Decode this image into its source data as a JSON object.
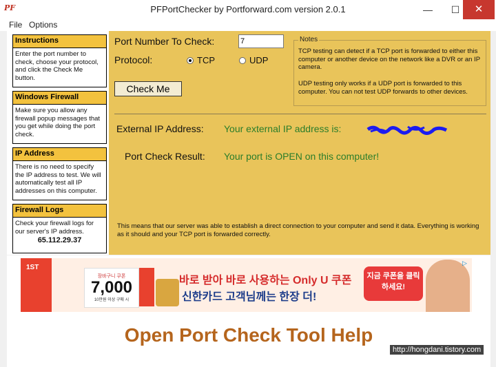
{
  "window": {
    "title": "PFPortChecker by Portforward.com version 2.0.1",
    "minimize": "—",
    "maximize": "☐",
    "close": "✕"
  },
  "menu": {
    "items": [
      "File",
      "Options"
    ]
  },
  "sidebar": {
    "instructions": {
      "title": "Instructions",
      "text": "Enter the port number to check, choose your protocol, and click the Check Me button."
    },
    "firewall": {
      "title": "Windows Firewall",
      "text": "Make sure you allow any firewall popup messages that you get while doing the port check."
    },
    "ip": {
      "title": "IP Address",
      "text": "There is no need to specify the IP address to test. We will automatically test all IP addresses on this computer."
    },
    "logs": {
      "title": "Firewall Logs",
      "text": "Check your firewall logs for our server's IP address.",
      "server_ip": "65.112.29.37"
    }
  },
  "form": {
    "port_label": "Port Number To Check:",
    "port_value": "7",
    "protocol_label": "Protocol:",
    "tcp_label": "TCP",
    "udp_label": "UDP",
    "selected_protocol": "TCP",
    "check_button": "Check Me"
  },
  "notes": {
    "title": "Notes",
    "tcp": "TCP testing can detect if a TCP port is forwarded to either this computer or another device on the network like a DVR or an IP camera.",
    "udp": "UDP testing only works if a UDP port is forwarded to this computer. You can not test UDP forwards to other devices."
  },
  "result": {
    "ext_ip_label": "External IP Address:",
    "ext_ip_value": "Your external IP address is:",
    "check_label": "Port Check Result:",
    "check_value": "Your port is OPEN on this computer!",
    "explanation": "This means that our server was able to establish a direct connection to your computer and send it data. Everything is working as it should and your TCP port is forwarded correctly."
  },
  "ad": {
    "badge": "1ST",
    "card_top": "장바구니 쿠폰",
    "card_amount": "7,000",
    "card_bottom": "10만원 이상 구매 시",
    "line1": "바로 받아 바로 사용하는 Only U 쿠폰",
    "line2": "신한카드 고객님께는 한장 더!",
    "bubble": "지금 쿠폰을 클릭하세요!"
  },
  "help": {
    "title": "Open Port Check Tool Help"
  },
  "watermark": "http://hongdani.tistory.com",
  "colors": {
    "panel": "#e9c45a",
    "header": "#f3c23e",
    "result_green": "#2a7d2a",
    "help_title": "#b5651d"
  }
}
